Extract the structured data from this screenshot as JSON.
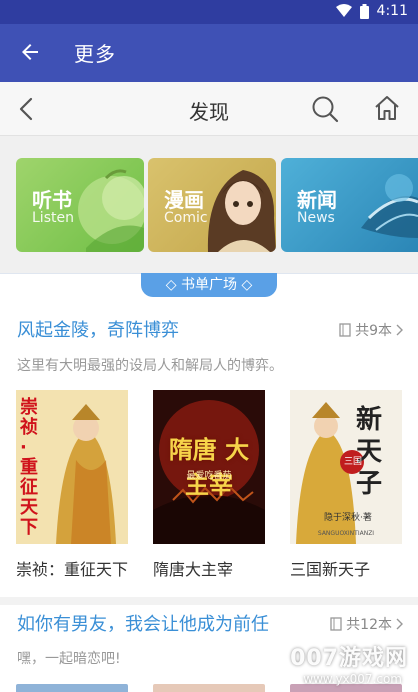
{
  "status_bar": {
    "time": "4:11"
  },
  "app_bar": {
    "title": "更多"
  },
  "nav_bar": {
    "title": "发现"
  },
  "categories": [
    {
      "cn": "听书",
      "en": "Listen"
    },
    {
      "cn": "漫画",
      "en": "Comic"
    },
    {
      "cn": "新闻",
      "en": "News"
    }
  ],
  "tagline": "◇ 书单广场 ◇",
  "lists": [
    {
      "title": "风起金陵，奇阵博弈",
      "count": "共9本",
      "description": "这里有大明最强的设局人和解局人的博弈。",
      "books": [
        {
          "title": "崇祯：重征天下",
          "cover_text": "崇祯·重征天下"
        },
        {
          "title": "隋唐大主宰",
          "cover_text": "隋唐 大主宰",
          "cover_sub": "最爱吃番茄"
        },
        {
          "title": "三国新天子",
          "cover_text": "新天子",
          "cover_badge": "三国",
          "cover_author": "隐于深秋·著",
          "cover_pinyin": "SANGUOXINTIANZI"
        }
      ]
    },
    {
      "title": "如你有男友，我会让他成为前任",
      "count": "共12本",
      "description": "嘿，一起暗恋吧!"
    }
  ],
  "watermark": {
    "brand": "007游戏网",
    "url": "www.yx007.com"
  },
  "colors": {
    "status": "#2f3da0",
    "appbar": "#3f51b5",
    "accent": "#3a8fd6",
    "pill": "#5aa0e6"
  }
}
